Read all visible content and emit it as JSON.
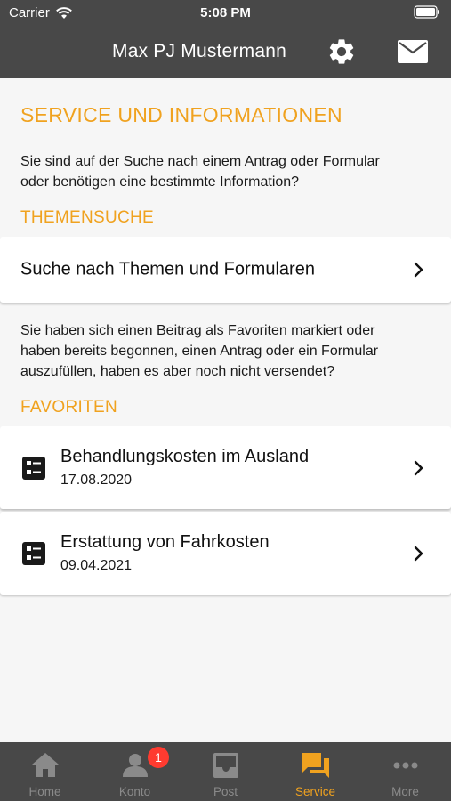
{
  "status_bar": {
    "carrier": "Carrier",
    "time": "5:08 PM"
  },
  "header": {
    "title": "Max PJ Mustermann",
    "settings_icon": "gear-icon",
    "mail_icon": "mail-icon"
  },
  "main": {
    "title": "SERVICE UND INFORMATIONEN",
    "intro_line1": "Sie sind auf der Suche nach einem Antrag oder Formular",
    "intro_line2": "oder benötigen eine bestimmte Information?",
    "themensuche_title": "THEMENSUCHE",
    "search_card_label": "Suche nach Themen und Formularen",
    "fav_intro_line1": "Sie haben sich einen Beitrag als Favoriten markiert oder",
    "fav_intro_line2": "haben bereits begonnen, einen Antrag oder ein Formular",
    "fav_intro_line3": "auszufüllen, haben es aber noch nicht versendet?",
    "favoriten_title": "FAVORITEN",
    "favorites": [
      {
        "title": "Behandlungskosten im Ausland",
        "date": "17.08.2020"
      },
      {
        "title": "Erstattung von Fahrkosten",
        "date": "09.04.2021"
      }
    ]
  },
  "tabbar": {
    "tabs": [
      {
        "label": "Home",
        "icon": "home-icon"
      },
      {
        "label": "Konto",
        "icon": "person-icon",
        "badge": "1"
      },
      {
        "label": "Post",
        "icon": "inbox-icon"
      },
      {
        "label": "Service",
        "icon": "chat-icon",
        "active": true
      },
      {
        "label": "More",
        "icon": "more-icon"
      }
    ]
  },
  "colors": {
    "accent": "#f0a21f",
    "bar": "#484848",
    "background": "#f6f6f6",
    "badge": "#ff3b30"
  }
}
